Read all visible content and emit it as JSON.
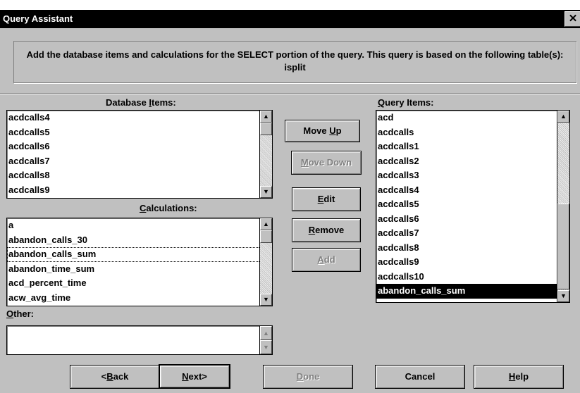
{
  "window": {
    "title": "Query Assistant",
    "close_glyph": "✕"
  },
  "instruction": "Add the database items and calculations for the SELECT portion of the query. This query is based on the following table(s): isplit",
  "database_items": {
    "label_pre": "Database ",
    "label_mnemonic": "I",
    "label_post": "tems:",
    "items": [
      "acdcalls4",
      "acdcalls5",
      "acdcalls6",
      "acdcalls7",
      "acdcalls8",
      "acdcalls9"
    ]
  },
  "calculations": {
    "label_mnemonic": "C",
    "label_post": "alculations:",
    "items": [
      "a",
      "abandon_calls_30",
      "abandon_calls_sum",
      "abandon_time_sum",
      "acd_percent_time",
      "acw_avg_time"
    ],
    "focused_item": "abandon_calls_sum"
  },
  "other": {
    "label_mnemonic": "O",
    "label_post": "ther:",
    "value": ""
  },
  "query_items": {
    "label_mnemonic": "Q",
    "label_post": "uery Items:",
    "items": [
      "acd",
      "acdcalls",
      "acdcalls1",
      "acdcalls2",
      "acdcalls3",
      "acdcalls4",
      "acdcalls5",
      "acdcalls6",
      "acdcalls7",
      "acdcalls8",
      "acdcalls9",
      "acdcalls10",
      "abandon_calls_sum"
    ],
    "selected_item": "abandon_calls_sum"
  },
  "actions": {
    "move_up": {
      "pre": "Move ",
      "mn": "U",
      "post": "p",
      "enabled": true
    },
    "move_down": {
      "pre": "",
      "mn": "M",
      "post": "ove Down",
      "enabled": false
    },
    "edit": {
      "pre": "",
      "mn": "E",
      "post": "dit",
      "enabled": true
    },
    "remove": {
      "pre": "",
      "mn": "R",
      "post": "emove",
      "enabled": true
    },
    "add": {
      "pre": "",
      "mn": "A",
      "post": "dd",
      "enabled": false
    }
  },
  "footer": {
    "back": {
      "pre": "<",
      "mn": "B",
      "post": "ack"
    },
    "next": {
      "pre": "",
      "mn": "N",
      "post": "ext>"
    },
    "done": {
      "pre": "",
      "mn": "D",
      "post": "one",
      "enabled": false
    },
    "cancel": {
      "label": "Cancel"
    },
    "help": {
      "pre": "",
      "mn": "H",
      "post": "elp"
    }
  },
  "icons": {
    "scroll_up": "▲",
    "scroll_down": "▼"
  }
}
